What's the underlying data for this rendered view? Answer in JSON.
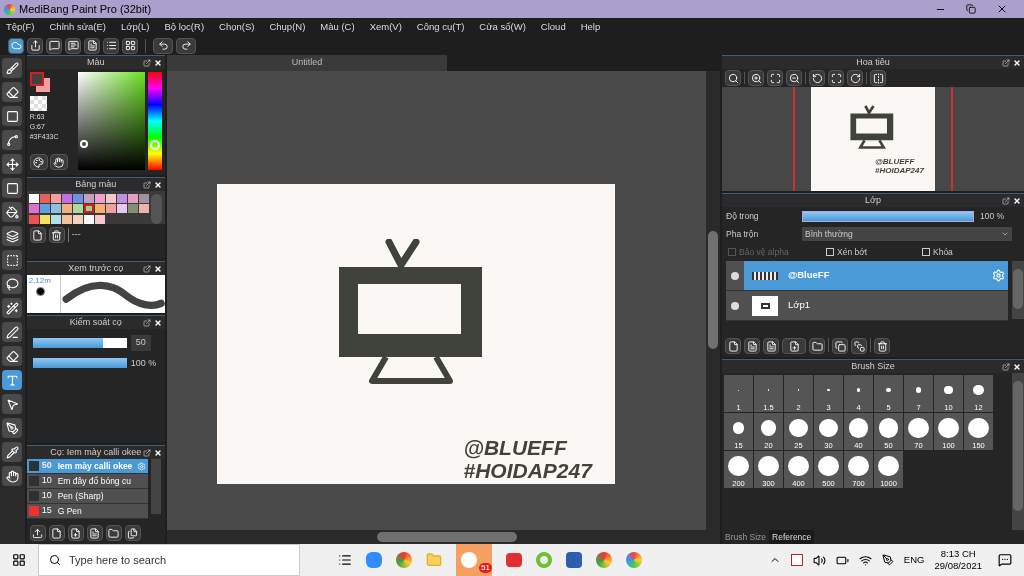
{
  "window": {
    "title": "MediBang Paint Pro (32bit)"
  },
  "menu": [
    "Tệp(F)",
    "Chỉnh sửa(E)",
    "Lớp(L)",
    "Bộ lọc(R)",
    "Chọn(S)",
    "Chụp(N)",
    "Màu (C)",
    "Xem(V)",
    "Công cụ(T)",
    "Cửa sổ(W)",
    "Cloud",
    "Help"
  ],
  "tools": [
    {
      "kind": "brush",
      "selected": false
    },
    {
      "kind": "eraser",
      "selected": false
    },
    {
      "kind": "dot",
      "selected": false
    },
    {
      "kind": "polyline",
      "selected": false
    },
    {
      "kind": "move",
      "selected": false
    },
    {
      "kind": "fill",
      "selected": false
    },
    {
      "kind": "bucket",
      "selected": false
    },
    {
      "kind": "gradient",
      "selected": false
    },
    {
      "kind": "marquee",
      "selected": false
    },
    {
      "kind": "lasso",
      "selected": false
    },
    {
      "kind": "wand",
      "selected": false
    },
    {
      "kind": "selectpen",
      "selected": false
    },
    {
      "kind": "selecteraser",
      "selected": false
    },
    {
      "kind": "text",
      "selected": true
    },
    {
      "kind": "operation",
      "selected": false
    },
    {
      "kind": "pen",
      "selected": false
    },
    {
      "kind": "dropper",
      "selected": false
    },
    {
      "kind": "hand",
      "selected": false
    }
  ],
  "color_panel": {
    "title": "Màu",
    "colors": [
      {
        "color": "#3f433c",
        "selected": true
      },
      {
        "color": "#f4a0a0",
        "selected": false
      }
    ],
    "readouts": [
      "R:63",
      "G:67",
      "#3F433C"
    ]
  },
  "palette_panel": {
    "title": "Bảng màu",
    "swatches": [
      {
        "color": "#ffffff",
        "selected": false
      },
      {
        "color": "#e8605a",
        "selected": false
      },
      {
        "color": "#f4a0a0",
        "selected": false
      },
      {
        "color": "#c070e0",
        "selected": false
      },
      {
        "color": "#7090e0",
        "selected": false
      },
      {
        "color": "#c0a0c0",
        "selected": false
      },
      {
        "color": "#f0a0d0",
        "selected": false
      },
      {
        "color": "#f0c8c8",
        "selected": false
      },
      {
        "color": "#c090e0",
        "selected": false
      },
      {
        "color": "#e0a0c0",
        "selected": false
      },
      {
        "color": "#a090a0",
        "selected": false
      },
      {
        "color": "#e070d0",
        "selected": false
      },
      {
        "color": "#60a0e0",
        "selected": false
      },
      {
        "color": "#90c0e0",
        "selected": false
      },
      {
        "color": "#f0b080",
        "selected": false
      },
      {
        "color": "#b0d8a0",
        "selected": false
      },
      {
        "color": "#a0d090",
        "selected": true
      },
      {
        "color": "#f8b070",
        "selected": false
      },
      {
        "color": "#f0a0a0",
        "selected": false
      },
      {
        "color": "#e8c8f0",
        "selected": false
      },
      {
        "color": "#809070",
        "selected": false
      },
      {
        "color": "#f0b0b0",
        "selected": false
      },
      {
        "color": "#f05050",
        "selected": false
      },
      {
        "color": "#f8e060",
        "selected": false
      },
      {
        "color": "#b0e0e8",
        "selected": false
      },
      {
        "color": "#f0c0a0",
        "selected": false
      },
      {
        "color": "#f8d0c0",
        "selected": false
      },
      {
        "color": "#fafafa",
        "selected": false
      },
      {
        "color": "#f8c8d0",
        "selected": false
      }
    ],
    "palette_name": "---"
  },
  "preview_panel": {
    "title": "Xem trước cọ",
    "size": "2.12m"
  },
  "brush_control": {
    "title": "Kiểm soát cọ",
    "size": {
      "level": 0.75,
      "reading": "50"
    },
    "opacity": {
      "level": 1,
      "reading": "100 %"
    }
  },
  "brush_panel": {
    "title": "Cọ: Iem mày calli okee",
    "brushes": [
      {
        "color": "#2e3033",
        "size": "50",
        "name": "Iem mày calli okee",
        "selected": true
      },
      {
        "color": "#2e3033",
        "size": "10",
        "name": "Em đây đổ bóng cu",
        "selected": false
      },
      {
        "color": "#2e3033",
        "size": "10",
        "name": "Pen (Sharp)",
        "selected": false
      },
      {
        "color": "#ee3030",
        "size": "15",
        "name": "G Pen",
        "selected": false
      }
    ]
  },
  "document": {
    "tab": "Untitled",
    "canvas_texts": [
      "@BLUEFF",
      "#HOIDAP247"
    ]
  },
  "navigator": {
    "title": "Hoa tiêu",
    "preview_texts": [
      "@BLUEFF",
      "#HOIDAP247"
    ]
  },
  "layers_panel": {
    "title": "Lớp",
    "opacity": {
      "label": "Độ trong",
      "level": 1,
      "reading": "100 %"
    },
    "blend": {
      "label": "Pha trộn",
      "value": "Bình thường"
    },
    "options": [
      {
        "label": "Bảo vệ alpha",
        "checked": false,
        "disabled": true
      },
      {
        "label": "Xén bớt",
        "checked": false,
        "disabled": false
      },
      {
        "label": "Khóa",
        "checked": false,
        "disabled": false
      }
    ],
    "layers": [
      {
        "name": "@BlueFF",
        "selected": true,
        "kind": "text"
      },
      {
        "name": "Lớp1",
        "selected": false,
        "kind": "drawing"
      }
    ]
  },
  "brush_size_panel": {
    "title": "Brush Size",
    "sizes": [
      "1",
      "1.5",
      "2",
      "3",
      "4",
      "5",
      "7",
      "10",
      "12",
      "15",
      "20",
      "25",
      "30",
      "40",
      "50",
      "70",
      "100",
      "150",
      "200",
      "300",
      "400",
      "500",
      "700",
      "1000"
    ],
    "tabs": [
      {
        "label": "Brush Size",
        "selected": true
      },
      {
        "label": "Reference",
        "selected": false
      }
    ]
  },
  "taskbar": {
    "search_placeholder": "Type here to search",
    "badge": "51",
    "language": "ENG",
    "time": "8:13 CH",
    "date": "29/08/2021"
  }
}
